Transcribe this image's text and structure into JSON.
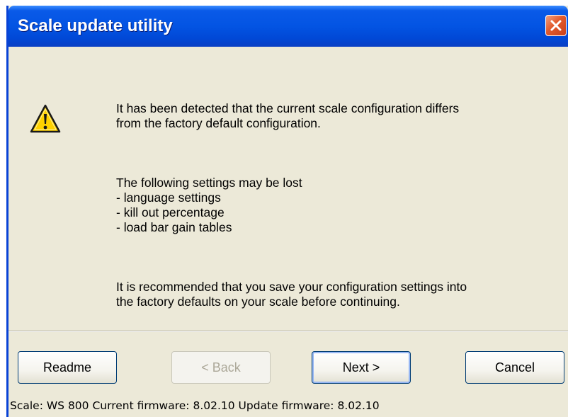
{
  "window": {
    "title": "Scale update utility"
  },
  "message": {
    "icon": "warning-icon",
    "paragraph1": "It has been detected that the current scale configuration differs\nfrom the factory default configuration.",
    "paragraph2": "The following settings may be lost\n- language settings\n- kill out percentage\n- load bar gain tables",
    "paragraph3": "It is recommended that you save your configuration settings into\nthe factory defaults on your scale before continuing."
  },
  "buttons": {
    "readme": "Readme",
    "back": "< Back",
    "next": "Next >",
    "cancel": "Cancel"
  },
  "status": {
    "text": "Scale: WS 800 Current firmware: 8.02.10 Update firmware: 8.02.10"
  },
  "colors": {
    "titlebar": "#0354e3",
    "dialog_bg": "#ece9d8",
    "close_button": "#e25a2c",
    "warning_yellow": "#ffd200"
  }
}
